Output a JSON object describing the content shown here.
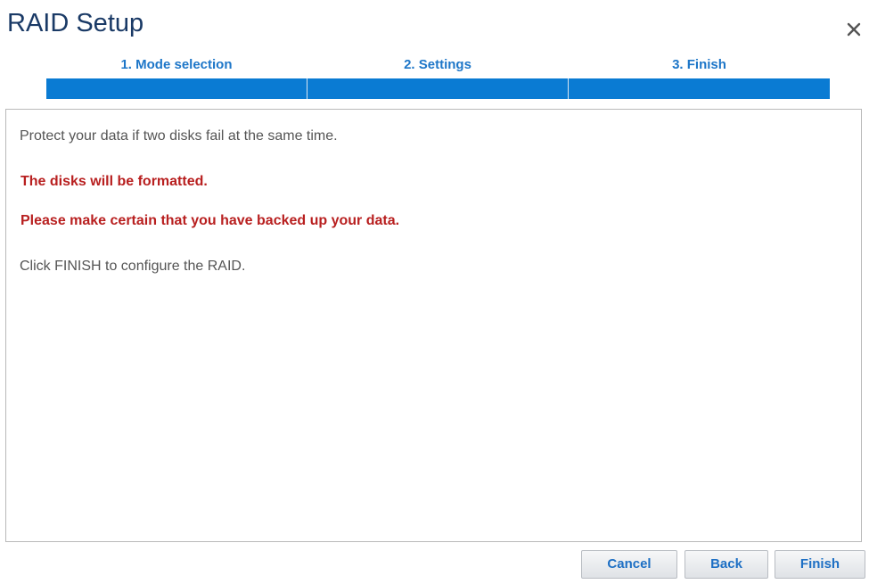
{
  "dialog": {
    "title": "RAID Setup",
    "close_icon": "close-icon"
  },
  "steps": [
    {
      "label": "1. Mode selection"
    },
    {
      "label": "2. Settings"
    },
    {
      "label": "3. Finish"
    }
  ],
  "progress": {
    "current_step": 3,
    "total_steps": 3
  },
  "content": {
    "description": "Protect your data if two disks fail at the same time.",
    "warning_format": "The disks will be formatted.",
    "warning_backup": "Please make certain that you have backed up your data.",
    "instruction": "Click FINISH to configure the RAID."
  },
  "buttons": {
    "cancel": "Cancel",
    "back": "Back",
    "finish": "Finish"
  },
  "colors": {
    "title": "#1a3a66",
    "step_label": "#1d76c8",
    "progress_bar": "#0a7bd3",
    "warning": "#b81f1f",
    "button_text": "#1d6fc4"
  }
}
